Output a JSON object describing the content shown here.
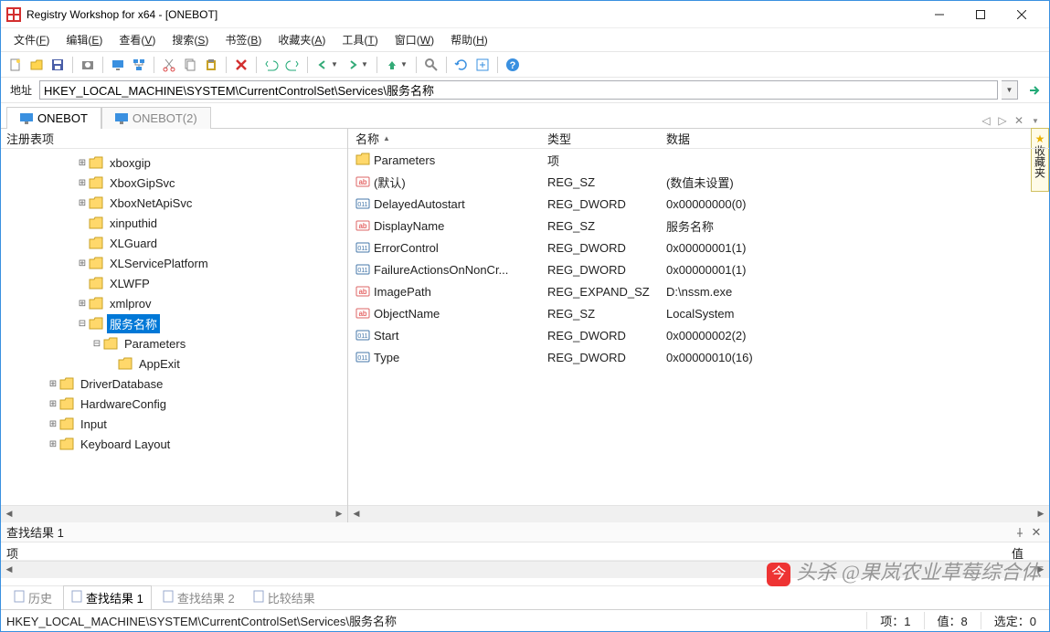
{
  "window": {
    "title": "Registry Workshop for x64 - [ONEBOT]"
  },
  "menus": [
    {
      "label": "文件",
      "key": "F"
    },
    {
      "label": "编辑",
      "key": "E"
    },
    {
      "label": "查看",
      "key": "V"
    },
    {
      "label": "搜索",
      "key": "S"
    },
    {
      "label": "书签",
      "key": "B"
    },
    {
      "label": "收藏夹",
      "key": "A"
    },
    {
      "label": "工具",
      "key": "T"
    },
    {
      "label": "窗口",
      "key": "W"
    },
    {
      "label": "帮助",
      "key": "H"
    }
  ],
  "address": {
    "label": "地址",
    "value": "HKEY_LOCAL_MACHINE\\SYSTEM\\CurrentControlSet\\Services\\服务名称"
  },
  "tabs": [
    {
      "label": "ONEBOT",
      "active": true
    },
    {
      "label": "ONEBOT(2)",
      "active": false
    }
  ],
  "sidebar_tab": "收藏夹",
  "left_pane": {
    "header": "注册表项",
    "nodes": [
      {
        "indent": 5,
        "tog": "+",
        "label": "xboxgip"
      },
      {
        "indent": 5,
        "tog": "+",
        "label": "XboxGipSvc"
      },
      {
        "indent": 5,
        "tog": "+",
        "label": "XboxNetApiSvc"
      },
      {
        "indent": 5,
        "tog": "",
        "label": "xinputhid"
      },
      {
        "indent": 5,
        "tog": "",
        "label": "XLGuard"
      },
      {
        "indent": 5,
        "tog": "+",
        "label": "XLServicePlatform"
      },
      {
        "indent": 5,
        "tog": "",
        "label": "XLWFP"
      },
      {
        "indent": 5,
        "tog": "+",
        "label": "xmlprov"
      },
      {
        "indent": 5,
        "tog": "-",
        "label": "服务名称",
        "selected": true
      },
      {
        "indent": 6,
        "tog": "-",
        "label": "Parameters"
      },
      {
        "indent": 7,
        "tog": "",
        "label": "AppExit"
      },
      {
        "indent": 3,
        "tog": "+",
        "label": "DriverDatabase"
      },
      {
        "indent": 3,
        "tog": "+",
        "label": "HardwareConfig"
      },
      {
        "indent": 3,
        "tog": "+",
        "label": "Input"
      },
      {
        "indent": 3,
        "tog": "+",
        "label": "Keyboard Layout"
      }
    ]
  },
  "right_pane": {
    "columns": {
      "name": "名称",
      "type": "类型",
      "data": "数据"
    },
    "rows": [
      {
        "icon": "folder",
        "name": "Parameters",
        "type": "项",
        "data": ""
      },
      {
        "icon": "sz",
        "name": "(默认)",
        "type": "REG_SZ",
        "data": "(数值未设置)"
      },
      {
        "icon": "dword",
        "name": "DelayedAutostart",
        "type": "REG_DWORD",
        "data": "0x00000000(0)"
      },
      {
        "icon": "sz",
        "name": "DisplayName",
        "type": "REG_SZ",
        "data": "服务名称"
      },
      {
        "icon": "dword",
        "name": "ErrorControl",
        "type": "REG_DWORD",
        "data": "0x00000001(1)"
      },
      {
        "icon": "dword",
        "name": "FailureActionsOnNonCr...",
        "type": "REG_DWORD",
        "data": "0x00000001(1)"
      },
      {
        "icon": "sz",
        "name": "ImagePath",
        "type": "REG_EXPAND_SZ",
        "data": "D:\\nssm.exe"
      },
      {
        "icon": "sz",
        "name": "ObjectName",
        "type": "REG_SZ",
        "data": "LocalSystem"
      },
      {
        "icon": "dword",
        "name": "Start",
        "type": "REG_DWORD",
        "data": "0x00000002(2)"
      },
      {
        "icon": "dword",
        "name": "Type",
        "type": "REG_DWORD",
        "data": "0x00000010(16)"
      }
    ]
  },
  "results": {
    "title": "查找结果 1",
    "col_item": "项",
    "col_value": "值"
  },
  "bottom_tabs": [
    {
      "label": "历史",
      "active": false
    },
    {
      "label": "查找结果 1",
      "active": true
    },
    {
      "label": "查找结果 2",
      "active": false
    },
    {
      "label": "比较结果",
      "active": false
    }
  ],
  "status": {
    "path": "HKEY_LOCAL_MACHINE\\SYSTEM\\CurrentControlSet\\Services\\服务名称",
    "items": "项：1",
    "values": "值：8",
    "selected": "选定：0"
  },
  "watermark": "头杀 @果岚农业草莓综合体"
}
